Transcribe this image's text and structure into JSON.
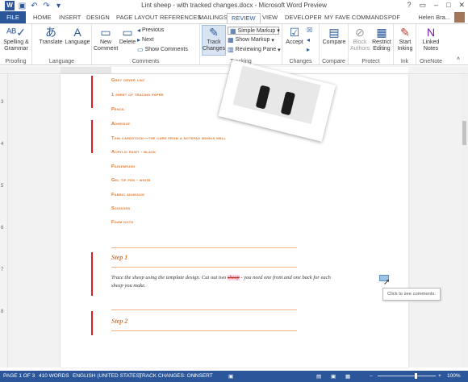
{
  "window": {
    "title": "Lint sheep - with tracked changes.docx - Microsoft Word Preview",
    "controls": [
      "?",
      "▭",
      "–",
      "□",
      "✕"
    ]
  },
  "tabs": [
    "FILE",
    "HOME",
    "INSERT",
    "DESIGN",
    "PAGE LAYOUT",
    "REFERENCES",
    "MAILINGS",
    "REVIEW",
    "VIEW",
    "DEVELOPER",
    "MY FAVE COMMANDS",
    "PDF"
  ],
  "active_tab": "REVIEW",
  "user": "Helen Bra...",
  "ribbon": {
    "proofing": {
      "label": "Proofing",
      "spelling": "Spelling &",
      "grammar": "Grammar"
    },
    "language": {
      "label": "Language",
      "translate": "Translate",
      "language": "Language"
    },
    "comments": {
      "label": "Comments",
      "new": "New",
      "comment": "Comment",
      "delete": "Delete",
      "previous": "Previous",
      "next": "Next",
      "show": "Show Comments"
    },
    "tracking": {
      "label": "Tracking",
      "track": "Track",
      "changes": "Changes",
      "markup_select": "Simple Markup",
      "show_markup": "Show Markup",
      "reviewing_pane": "Reviewing Pane"
    },
    "changes": {
      "label": "Changes",
      "accept": "Accept"
    },
    "compare": {
      "label": "Compare",
      "compare": "Compare"
    },
    "protect": {
      "label": "Protect",
      "block": "Block",
      "authors": "Authors",
      "restrict": "Restrict",
      "editing": "Editing"
    },
    "ink": {
      "label": "Ink",
      "start": "Start",
      "inking": "Inking"
    },
    "onenote": {
      "label": "OneNote",
      "linked": "Linked",
      "notes": "Notes"
    }
  },
  "ruler_numbers": [
    "3",
    "4",
    "5",
    "6",
    "7",
    "8"
  ],
  "materials": [
    "Grey dryer lint",
    "1 sheet of tracing paper",
    "Pencil",
    "Adhesive",
    "Thin cardstock—the card from a notepad works well",
    "Acrylic paint - black",
    "Paintbrush",
    "Gel tip pen - white",
    "Fabric adhesive",
    "Scissors",
    "Foam dots"
  ],
  "step1": {
    "heading": "Step 1",
    "text_before": "Trace the sheep using the template design. Cut out two ",
    "deleted": "sheep",
    "text_after": " - you need one front and one back for each",
    "line2": "sheep you make."
  },
  "step2": {
    "heading": "Step 2"
  },
  "tooltip": "Click to see comments.",
  "status": {
    "page": "PAGE 1 OF 3",
    "words": "410 WORDS",
    "language": "ENGLISH (UNITED STATES)",
    "track": "TRACK CHANGES: ON",
    "insert": "INSERT",
    "zoom": "100%",
    "zoom_minus": "–",
    "zoom_plus": "+"
  },
  "colors": {
    "accent": "#2b579a",
    "material_orange": "#e3762a",
    "change_bar": "#e01c24"
  }
}
